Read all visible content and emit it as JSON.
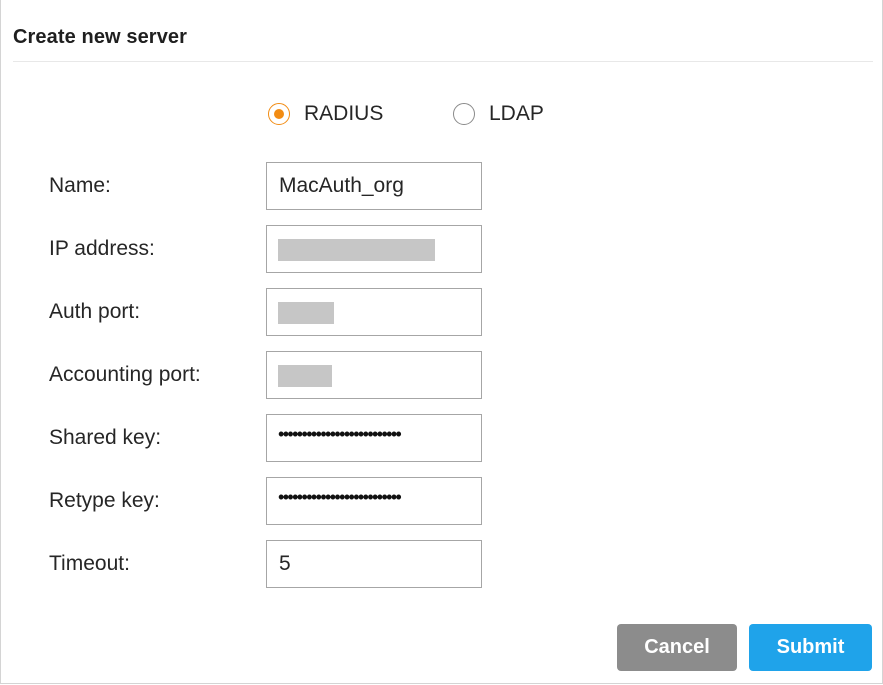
{
  "dialog": {
    "title": "Create new server"
  },
  "server_type": {
    "options": [
      {
        "label": "RADIUS",
        "selected": true
      },
      {
        "label": "LDAP",
        "selected": false
      }
    ],
    "accent_color": "#f28c13"
  },
  "form": {
    "name": {
      "label": "Name:",
      "value": "MacAuth_org"
    },
    "ip_address": {
      "label": "IP address:",
      "value": "",
      "redacted": true
    },
    "auth_port": {
      "label": "Auth port:",
      "value": "",
      "redacted": true
    },
    "accounting_port": {
      "label": "Accounting port:",
      "value": "",
      "redacted": true
    },
    "shared_key": {
      "label": "Shared key:",
      "masked_value": "••••••••••••••••••••••••••"
    },
    "retype_key": {
      "label": "Retype key:",
      "masked_value": "••••••••••••••••••••••••••"
    },
    "timeout": {
      "label": "Timeout:",
      "value": "5"
    }
  },
  "actions": {
    "cancel_label": "Cancel",
    "submit_label": "Submit",
    "cancel_color": "#8c8c8c",
    "submit_color": "#1fa3ea"
  }
}
